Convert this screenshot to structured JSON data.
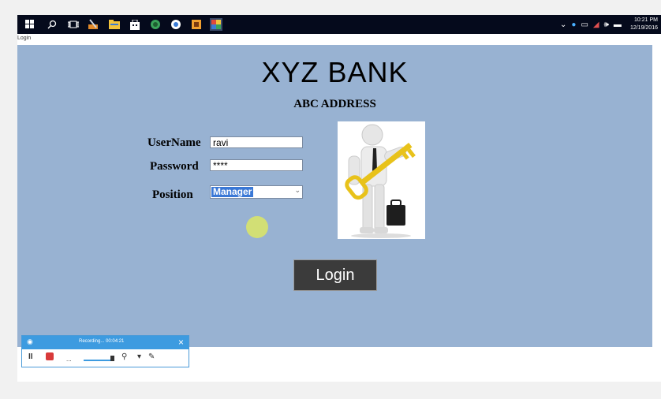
{
  "taskbar": {
    "icons": [
      "windows-start-icon",
      "search-icon",
      "task-view-icon",
      "tools-icon",
      "file-explorer-icon",
      "store-icon",
      "android-studio-icon",
      "chrome-icon",
      "media-icon",
      "app-icon"
    ],
    "clock_time": "10:21 PM",
    "clock_date": "12/19/2016"
  },
  "window": {
    "title": "Login"
  },
  "form": {
    "bank_name": "XYZ BANK",
    "address": "ABC ADDRESS",
    "username_label": "UserName",
    "username_value": "ravi",
    "password_label": "Password",
    "password_value": "****",
    "position_label": "Position",
    "position_value": "Manager",
    "login_label": "Login"
  },
  "recorder": {
    "status": "Recording... 00:04:21"
  },
  "colors": {
    "form_bg": "#98b2d2",
    "taskbar_bg": "#050a1c",
    "button_bg": "#3b3b3b",
    "recorder_accent": "#3d9be0",
    "key_gold": "#e8c21a"
  }
}
